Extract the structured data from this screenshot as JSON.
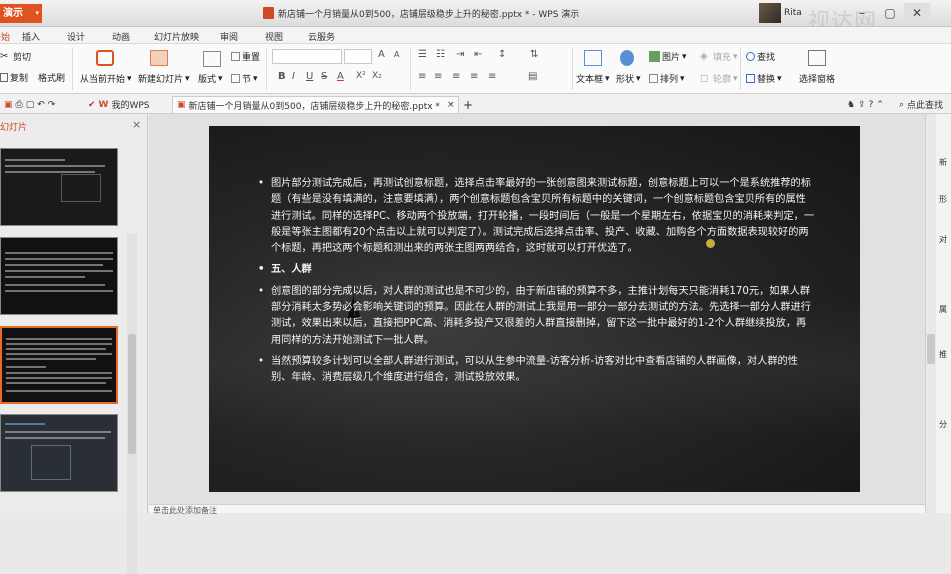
{
  "app": {
    "button_label": "演示",
    "window_title": "新店铺一个月销量从0到500，店铺层级稳步上升的秘密.pptx * - WPS 演示",
    "user": "Rita",
    "watermark": "视达网"
  },
  "menu": [
    "开始",
    "插入",
    "设计",
    "动画",
    "幻灯片放映",
    "审阅",
    "视图",
    "云服务"
  ],
  "ribbon": {
    "cut": "剪切",
    "copy": "复制",
    "format_painter": "格式刷",
    "play_from_current": "从当前开始",
    "new_slide": "新建幻灯片",
    "layout": "版式",
    "section": "节",
    "reset": "重置",
    "text_box": "文本框",
    "shape": "形状",
    "picture": "图片",
    "fill": "填充",
    "arrange": "排列",
    "outline": "轮廓",
    "find": "查找",
    "replace": "替换",
    "selection_pane": "选择窗格",
    "font_bold": "B",
    "font_italic": "I",
    "font_underline": "U",
    "font_strike": "S",
    "grow": "A",
    "shrink": "A"
  },
  "tabs": {
    "home": "我的WPS",
    "doc": "新店铺一个月销量从0到500，店铺层级稳步上升的秘密.pptx *",
    "add": "+",
    "search_hint": "点此查找"
  },
  "panel": {
    "title": "幻灯片",
    "close": "×",
    "notes_hint": "单击此处添加备注"
  },
  "slide": {
    "bullets": [
      {
        "text": "图片部分测试完成后，再测试创意标题，选择点击率最好的一张创意图来测试标题，创意标题上可以一个是系统推荐的标题（有些是没有填满的，注意要填满），两个创意标题包含宝贝所有标题中的关键词，一个创意标题包含宝贝所有的属性进行测试。同样的选择PC、移动两个投放端，打开轮播，一段时间后（一般是一个星期左右，依据宝贝的消耗来判定，一般是等张主图都有20个点击以上就可以判定了）。测试完成后选择点击率、投产、收藏、加购各个方面数据表现较好的两个标题，再把这两个标题和测出来的两张主图两两结合，这时就可以打开优选了。",
        "heading": false
      },
      {
        "text": "五、人群",
        "heading": true
      },
      {
        "text": "创意图的部分完成以后，对人群的测试也是不可少的，由于新店铺的预算不多，主推计划每天只能消耗170元，如果人群部分消耗太多势必会影响关键词的预算。因此在人群的测试上我是用一部分一部分去测试的方法。先选择一部分人群进行测试，效果出来以后，直接把PPC高、消耗多投产又很差的人群直接删掉，留下这一批中最好的1-2个人群继续投放，再用同样的方法开始测试下一批人群。",
        "heading": false
      },
      {
        "text": "当然预算较多计划可以全部人群进行测试，可以从生参中流量-访客分析-访客对比中查看店铺的人群画像，对人群的性别、年龄、消费层级几个维度进行组合，测试投放效果。",
        "heading": false
      }
    ]
  },
  "right_strip": [
    "新",
    "形",
    "对",
    "属",
    "推",
    "分"
  ],
  "colors": {
    "accent": "#e0521f",
    "selected_thumb": "#e46d2c"
  }
}
